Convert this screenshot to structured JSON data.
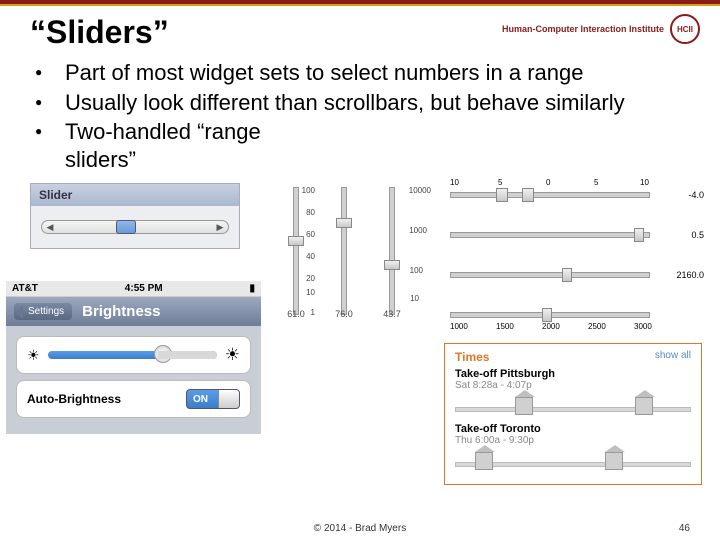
{
  "header": {
    "title": "“Sliders”",
    "institute": "Human-Computer Interaction Institute",
    "logo": "HCII"
  },
  "bullets": [
    "Part of most widget sets to select numbers in a range",
    "Usually look different than scrollbars, but behave similarly",
    "Two-handled “range sliders”"
  ],
  "mac_slider": {
    "title": "Slider"
  },
  "ios": {
    "carrier": "AT&T",
    "time": "4:55 PM",
    "back": "Settings",
    "title": "Brightness",
    "auto_label": "Auto-Brightness",
    "switch": "ON"
  },
  "vsliders": {
    "ticks1": [
      "100",
      "80",
      "60",
      "40",
      "20",
      "10",
      "1"
    ],
    "ticks3": [
      "10000",
      "1000",
      "100",
      "10",
      ""
    ],
    "bottoms": [
      "61.0",
      "76.0",
      "43.7"
    ]
  },
  "hsliders": {
    "row1_ticks": [
      "10",
      "5",
      "0",
      "5",
      "10"
    ],
    "row1_val": "-4.0",
    "row2_val": "0.5",
    "row3_val": "2160.0",
    "row4_ticks": [
      "1000",
      "1500",
      "2000",
      "2500",
      "3000"
    ]
  },
  "times": {
    "title": "Times",
    "show": "show all",
    "sec1_label": "Take-off Pittsburgh",
    "sec1_time": "Sat 8:28a - 4:07p",
    "sec2_label": "Take-off Toronto",
    "sec2_time": "Thu 6:00a - 9:30p"
  },
  "footer": {
    "copyright": "© 2014 - Brad Myers",
    "page": "46"
  }
}
